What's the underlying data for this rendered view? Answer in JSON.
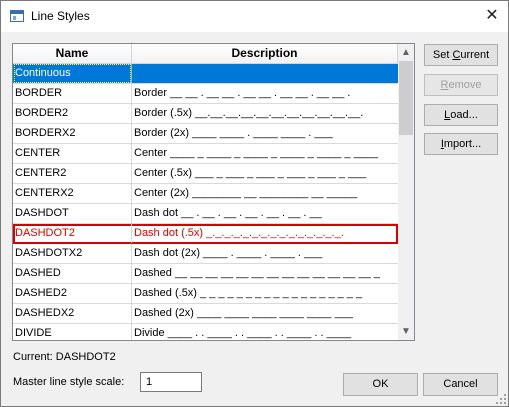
{
  "window": {
    "title": "Line Styles",
    "close_glyph": "✕"
  },
  "table": {
    "columns": [
      "Name",
      "Description"
    ],
    "rows": [
      {
        "name": "Continuous",
        "desc": ""
      },
      {
        "name": "BORDER",
        "desc": "Border __ __ . __ __ . __ __ . __ __ . __ __ ."
      },
      {
        "name": "BORDER2",
        "desc": "Border (.5x) __.__.__.__.__.__.__.__.__.__.__."
      },
      {
        "name": "BORDERX2",
        "desc": "Border (2x) ____ ____ . ____ ____ . ___"
      },
      {
        "name": "CENTER",
        "desc": "Center ____ _ ____ _ ____ _ ____ _ ____ _ ____"
      },
      {
        "name": "CENTER2",
        "desc": "Center (.5x) ___ _ ___ _ ___ _ ___ _ ___ _ ___"
      },
      {
        "name": "CENTERX2",
        "desc": "Center (2x) ________ __ ________ __ _____"
      },
      {
        "name": "DASHDOT",
        "desc": "Dash dot __ . __ . __ . __ . __ . __ . __"
      },
      {
        "name": "DASHDOT2",
        "desc": "Dash dot (.5x) _._._._._._._._._._._._._._._."
      },
      {
        "name": "DASHDOTX2",
        "desc": "Dash dot (2x) ____ . ____ . ____ . ___"
      },
      {
        "name": "DASHED",
        "desc": "Dashed __ __ __ __ __ __ __ __ __ __ __ __ __ _"
      },
      {
        "name": "DASHED2",
        "desc": "Dashed (.5x) _ _ _ _ _ _ _ _ _ _ _ _ _ _ _ _ _ _"
      },
      {
        "name": "DASHEDX2",
        "desc": "Dashed (2x) ____ ____ ____ ____ ____ ___"
      },
      {
        "name": "DIVIDE",
        "desc": "Divide ____ . . ____ . . ____ . . ____ . . ____"
      }
    ],
    "selected_index": 0,
    "highlight_index": 8
  },
  "buttons": {
    "set_current": {
      "pre": "Set ",
      "u": "C",
      "post": "urrent"
    },
    "remove": {
      "pre": "",
      "u": "R",
      "post": "emove"
    },
    "load": {
      "pre": "",
      "u": "L",
      "post": "oad..."
    },
    "import": {
      "pre": "",
      "u": "I",
      "post": "mport..."
    },
    "ok": "OK",
    "cancel": "Cancel"
  },
  "current_label": "Current: DASHDOT2",
  "scale": {
    "label": "Master line style scale:",
    "value": "1"
  },
  "scrollbar": {
    "up": "▲",
    "down": "▼"
  },
  "colors": {
    "selection": "#0078d7",
    "highlight": "#d80000"
  }
}
